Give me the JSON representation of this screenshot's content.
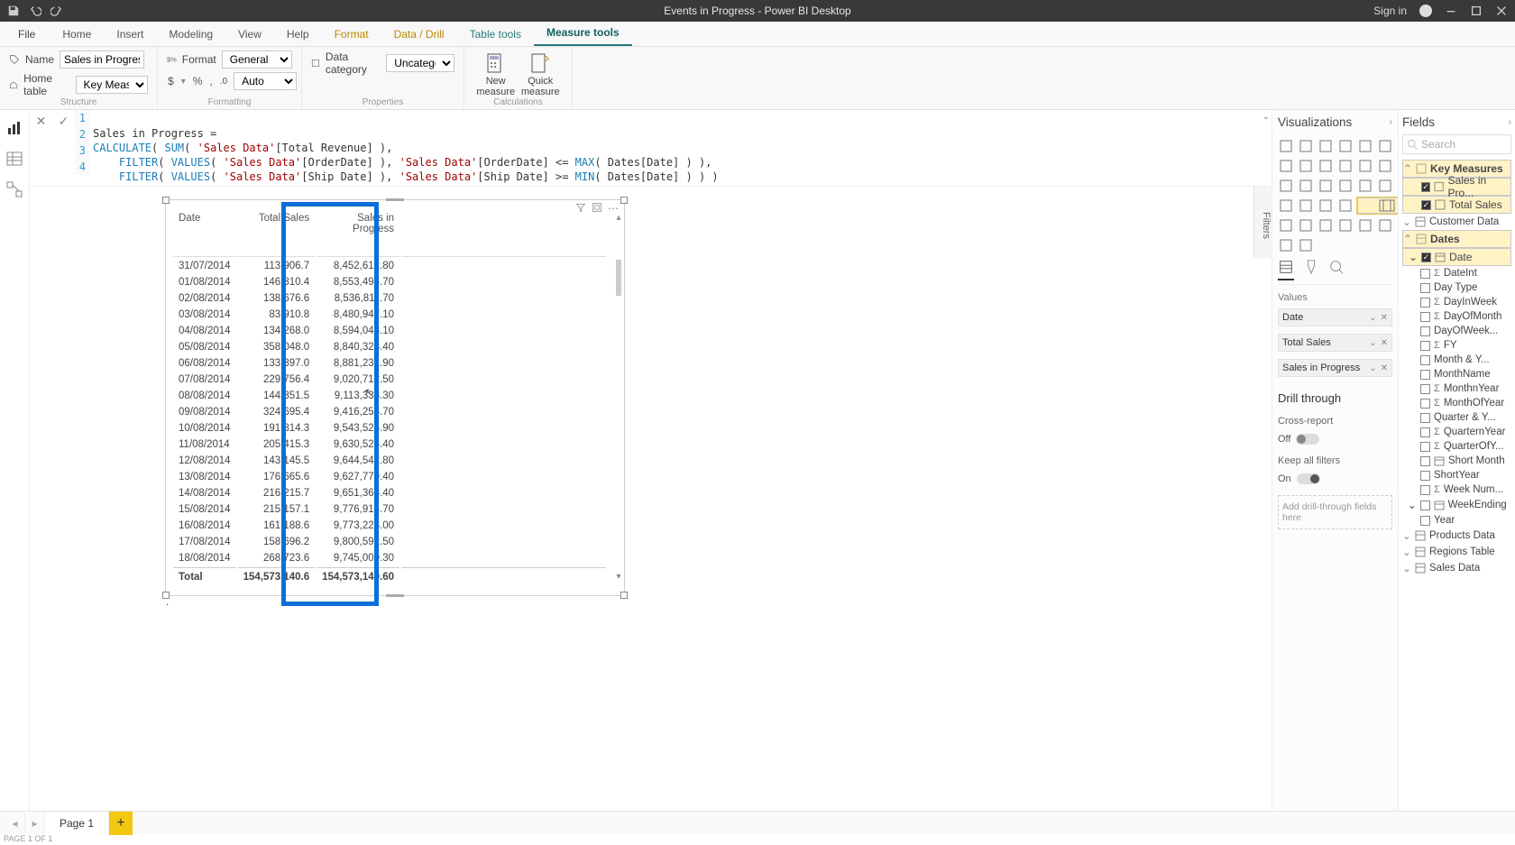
{
  "titlebar": {
    "title": "Events in Progress - Power BI Desktop",
    "signin": "Sign in"
  },
  "ribbon": {
    "file": "File",
    "tabs": [
      "Home",
      "Insert",
      "Modeling",
      "View",
      "Help",
      "Format",
      "Data / Drill",
      "Table tools",
      "Measure tools"
    ],
    "active": "Measure tools",
    "structure": {
      "name_label": "Name",
      "name_value": "Sales in Progress",
      "home_label": "Home table",
      "home_value": "Key Measures",
      "group": "Structure"
    },
    "formatting": {
      "format_label": "Format",
      "format_value": "General",
      "auto": "Auto",
      "group": "Formatting"
    },
    "properties": {
      "category_label": "Data category",
      "category_value": "Uncategorized",
      "group": "Properties"
    },
    "calculations": {
      "new_measure": "New measure",
      "quick_measure": "Quick measure",
      "group": "Calculations"
    }
  },
  "formula": {
    "lines": [
      {
        "n": "1",
        "plain": "Sales in Progress ="
      },
      {
        "n": "2"
      },
      {
        "n": "3"
      },
      {
        "n": "4"
      }
    ],
    "l1": "Sales in Progress =",
    "l2a": "CALCULATE",
    "l2b": "( ",
    "l2c": "SUM",
    "l2d": "( ",
    "l2e": "'Sales Data'",
    "l2f": "[Total Revenue] ),",
    "l3a": "    FILTER",
    "l3b": "( ",
    "l3c": "VALUES",
    "l3d": "( ",
    "l3e": "'Sales Data'",
    "l3f": "[OrderDate] ), ",
    "l3g": "'Sales Data'",
    "l3h": "[OrderDate] <= ",
    "l3i": "MAX",
    "l3j": "( Dates[Date] ) ),",
    "l4a": "    FILTER",
    "l4b": "( ",
    "l4c": "VALUES",
    "l4d": "( ",
    "l4e": "'Sales Data'",
    "l4f": "[Ship Date] ), ",
    "l4g": "'Sales Data'",
    "l4h": "[Ship Date] >= ",
    "l4i": "MIN",
    "l4j": "( Dates[Date] ) ) )"
  },
  "visual": {
    "columns": [
      "Date",
      "Total Sales",
      "Sales in Progress"
    ],
    "rows": [
      {
        "d": "31/07/2014",
        "t": "113,906.7",
        "s": "8,452,612.80"
      },
      {
        "d": "01/08/2014",
        "t": "146,810.4",
        "s": "8,553,494.70"
      },
      {
        "d": "02/08/2014",
        "t": "138,676.6",
        "s": "8,536,811.70"
      },
      {
        "d": "03/08/2014",
        "t": "83,910.8",
        "s": "8,480,947.10"
      },
      {
        "d": "04/08/2014",
        "t": "134,268.0",
        "s": "8,594,043.10"
      },
      {
        "d": "05/08/2014",
        "t": "358,048.0",
        "s": "8,840,328.40"
      },
      {
        "d": "06/08/2014",
        "t": "133,397.0",
        "s": "8,881,231.90"
      },
      {
        "d": "07/08/2014",
        "t": "229,756.4",
        "s": "9,020,712.50"
      },
      {
        "d": "08/08/2014",
        "t": "144,351.5",
        "s": "9,113,333.30"
      },
      {
        "d": "09/08/2014",
        "t": "324,695.4",
        "s": "9,416,253.70"
      },
      {
        "d": "10/08/2014",
        "t": "191,814.3",
        "s": "9,543,526.90"
      },
      {
        "d": "11/08/2014",
        "t": "205,415.3",
        "s": "9,630,526.40"
      },
      {
        "d": "12/08/2014",
        "t": "143,145.5",
        "s": "9,644,542.80"
      },
      {
        "d": "13/08/2014",
        "t": "176,665.6",
        "s": "9,627,779.40"
      },
      {
        "d": "14/08/2014",
        "t": "216,215.7",
        "s": "9,651,363.40"
      },
      {
        "d": "15/08/2014",
        "t": "215,157.1",
        "s": "9,776,914.70"
      },
      {
        "d": "16/08/2014",
        "t": "161,188.6",
        "s": "9,773,223.00"
      },
      {
        "d": "17/08/2014",
        "t": "158,696.2",
        "s": "9,800,592.50"
      },
      {
        "d": "18/08/2014",
        "t": "268,723.6",
        "s": "9,745,009.30"
      }
    ],
    "total_label": "Total",
    "total_t": "154,573,140.6",
    "total_s": "154,573,140.60"
  },
  "filters_tab": "Filters",
  "viz": {
    "title": "Visualizations",
    "values_label": "Values",
    "wells": [
      "Date",
      "Total Sales",
      "Sales in Progress"
    ],
    "drill_title": "Drill through",
    "cross": "Cross-report",
    "off": "Off",
    "keep": "Keep all filters",
    "on": "On",
    "drop": "Add drill-through fields here"
  },
  "fields": {
    "title": "Fields",
    "search_ph": "Search",
    "key_measures": "Key Measures",
    "sales_in_prog": "Sales in Pro...",
    "total_sales": "Total Sales",
    "customer_data": "Customer Data",
    "dates": "Dates",
    "dates_children": [
      {
        "n": "Date",
        "checked": true,
        "icon": "cal"
      },
      {
        "n": "DateInt",
        "checked": false,
        "icon": "sig"
      },
      {
        "n": "Day Type",
        "checked": false,
        "icon": ""
      },
      {
        "n": "DayInWeek",
        "checked": false,
        "icon": "sig"
      },
      {
        "n": "DayOfMonth",
        "checked": false,
        "icon": "sig"
      },
      {
        "n": "DayOfWeek...",
        "checked": false,
        "icon": ""
      },
      {
        "n": "FY",
        "checked": false,
        "icon": "sig"
      },
      {
        "n": "Month & Y...",
        "checked": false,
        "icon": ""
      },
      {
        "n": "MonthName",
        "checked": false,
        "icon": ""
      },
      {
        "n": "MonthnYear",
        "checked": false,
        "icon": "sig"
      },
      {
        "n": "MonthOfYear",
        "checked": false,
        "icon": "sig"
      },
      {
        "n": "Quarter & Y...",
        "checked": false,
        "icon": ""
      },
      {
        "n": "QuarternYear",
        "checked": false,
        "icon": "sig"
      },
      {
        "n": "QuarterOfY...",
        "checked": false,
        "icon": "sig"
      },
      {
        "n": "Short Month",
        "checked": false,
        "icon": "cal"
      },
      {
        "n": "ShortYear",
        "checked": false,
        "icon": ""
      },
      {
        "n": "Week Num...",
        "checked": false,
        "icon": "sig"
      },
      {
        "n": "WeekEnding",
        "checked": false,
        "icon": "cal"
      },
      {
        "n": "Year",
        "checked": false,
        "icon": ""
      }
    ],
    "products": "Products Data",
    "regions": "Regions Table",
    "sales": "Sales Data"
  },
  "pages": {
    "page1": "Page 1"
  },
  "status": "PAGE 1 OF 1"
}
